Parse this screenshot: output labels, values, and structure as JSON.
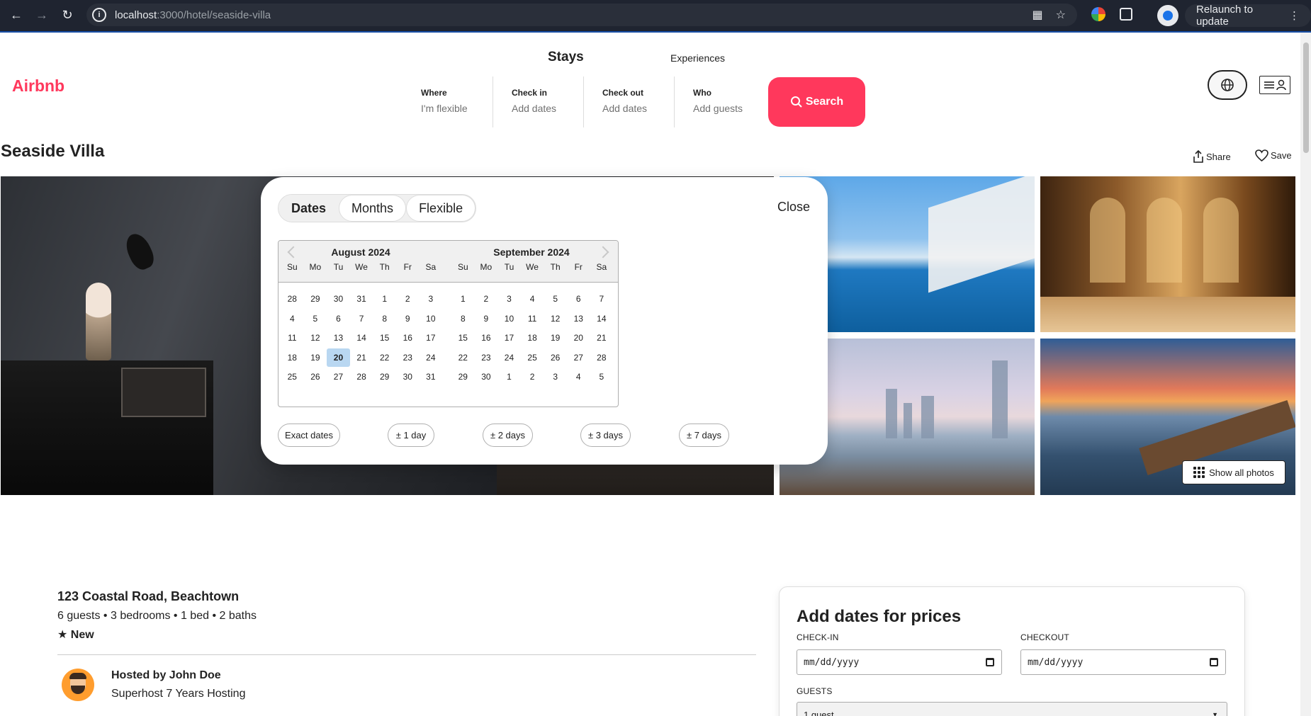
{
  "browser": {
    "url_host": "localhost",
    "url_path": ":3000/hotel/seaside-villa",
    "relaunch_label": "Relaunch to update"
  },
  "header": {
    "logo": "Airbnb",
    "tabs": [
      {
        "label": "Stays"
      },
      {
        "label": "Experiences"
      }
    ],
    "search": {
      "segments": [
        {
          "label": "Where",
          "value": "I'm flexible"
        },
        {
          "label": "Check in",
          "value": "Add dates"
        },
        {
          "label": "Check out",
          "value": "Add dates"
        },
        {
          "label": "Who",
          "value": "Add guests"
        }
      ],
      "button_label": "Search"
    }
  },
  "listing": {
    "title": "Seaside Villa",
    "share_label": "Share",
    "save_label": "Save",
    "show_all_photos": "Show all photos",
    "address": "123 Coastal Road, Beachtown",
    "specs": "6 guests • 3 bedrooms • 1 bed • 2 baths",
    "rating": "★ New",
    "host_name": "Hosted by John Doe",
    "host_sub": "Superhost 7 Years Hosting"
  },
  "picker": {
    "tabs": [
      {
        "label": "Dates"
      },
      {
        "label": "Months"
      },
      {
        "label": "Flexible"
      }
    ],
    "active_tab": "Dates",
    "close_label": "Close",
    "day_names": [
      "Su",
      "Mo",
      "Tu",
      "We",
      "Th",
      "Fr",
      "Sa"
    ],
    "months": [
      {
        "title": "August 2024",
        "weeks": [
          [
            "28",
            "29",
            "30",
            "31",
            "1",
            "2",
            "3"
          ],
          [
            "4",
            "5",
            "6",
            "7",
            "8",
            "9",
            "10"
          ],
          [
            "11",
            "12",
            "13",
            "14",
            "15",
            "16",
            "17"
          ],
          [
            "18",
            "19",
            "20",
            "21",
            "22",
            "23",
            "24"
          ],
          [
            "25",
            "26",
            "27",
            "28",
            "29",
            "30",
            "31"
          ]
        ],
        "highlighted": "20"
      },
      {
        "title": "September 2024",
        "weeks": [
          [
            "1",
            "2",
            "3",
            "4",
            "5",
            "6",
            "7"
          ],
          [
            "8",
            "9",
            "10",
            "11",
            "12",
            "13",
            "14"
          ],
          [
            "15",
            "16",
            "17",
            "18",
            "19",
            "20",
            "21"
          ],
          [
            "22",
            "23",
            "24",
            "25",
            "26",
            "27",
            "28"
          ],
          [
            "29",
            "30",
            "1",
            "2",
            "3",
            "4",
            "5"
          ]
        ],
        "highlighted": ""
      }
    ],
    "flex_options": [
      {
        "label": "Exact dates"
      },
      {
        "label": "± 1 day"
      },
      {
        "label": "± 2 days"
      },
      {
        "label": "± 3 days"
      },
      {
        "label": "± 7 days"
      }
    ]
  },
  "booking": {
    "title": "Add dates for prices",
    "checkin_label": "CHECK-IN",
    "checkout_label": "CHECKOUT",
    "date_placeholder": "mm/dd/yyyy",
    "guests_label": "GUESTS",
    "guests_value": "1 guest"
  },
  "colors": {
    "brand": "#ff385c",
    "highlight_day": "#b9d7f1"
  }
}
